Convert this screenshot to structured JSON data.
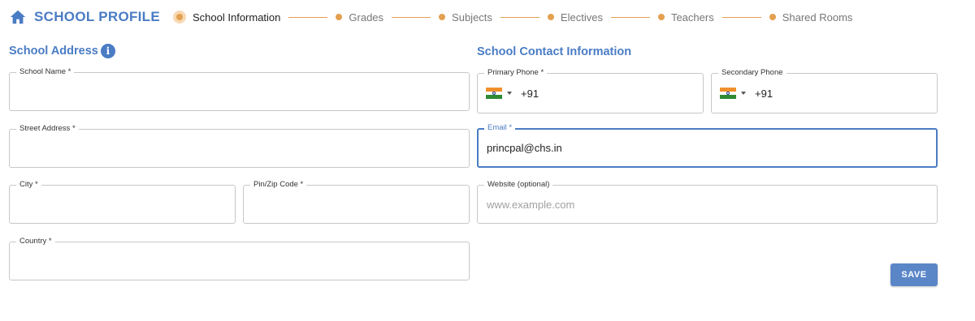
{
  "header": {
    "title": "SCHOOL PROFILE",
    "home_icon": "home-icon"
  },
  "stepper": {
    "steps": [
      {
        "label": "School Information",
        "active": true
      },
      {
        "label": "Grades",
        "active": false
      },
      {
        "label": "Subjects",
        "active": false
      },
      {
        "label": "Electives",
        "active": false
      },
      {
        "label": "Teachers",
        "active": false
      },
      {
        "label": "Shared Rooms",
        "active": false
      }
    ],
    "accent_color": "#e3a050"
  },
  "address": {
    "title": "School Address",
    "info_icon": "info-icon",
    "school_name": {
      "label": "School Name *",
      "value": ""
    },
    "street": {
      "label": "Street Address *",
      "value": ""
    },
    "city": {
      "label": "City *",
      "value": ""
    },
    "pin": {
      "label": "Pin/Zip Code *",
      "value": ""
    },
    "country": {
      "label": "Country *",
      "value": ""
    }
  },
  "contact": {
    "title": "School Contact Information",
    "primary_phone": {
      "label": "Primary Phone *",
      "country_code": "+91",
      "flag": "india-flag-icon"
    },
    "secondary_phone": {
      "label": "Secondary Phone",
      "country_code": "+91",
      "flag": "india-flag-icon"
    },
    "email": {
      "label": "Email *",
      "value": "princpal@chs.in"
    },
    "website": {
      "label": "Website (optional)",
      "value": "",
      "placeholder": "www.example.com"
    }
  },
  "actions": {
    "save_label": "SAVE"
  },
  "colors": {
    "primary": "#4a7cc4",
    "accent": "#e3a050",
    "button": "#5a86c8"
  }
}
